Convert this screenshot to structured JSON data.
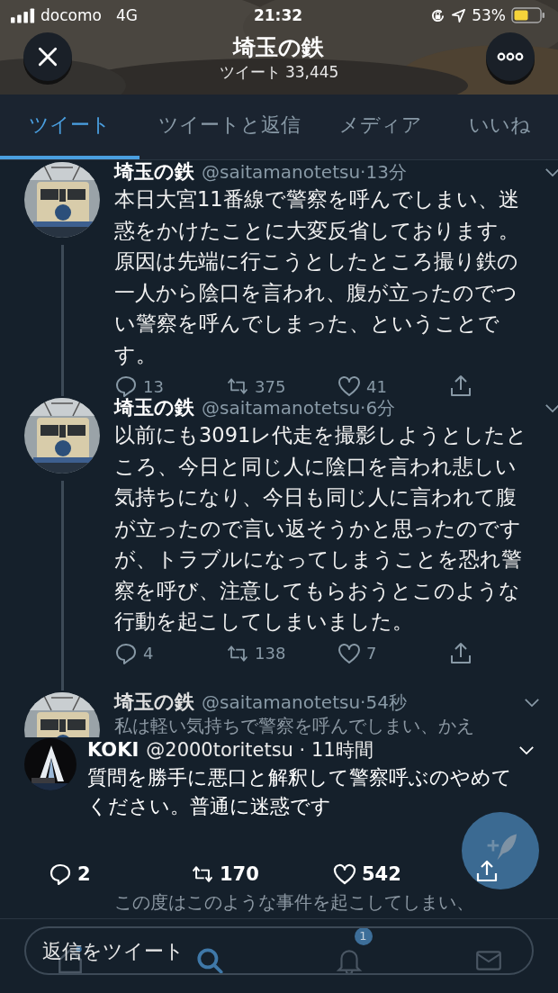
{
  "status_bar": {
    "carrier": "docomo",
    "network": "4G",
    "time": "21:32",
    "battery": "53%"
  },
  "header": {
    "title": "埼玉の鉄",
    "subtitle": "ツイート 33,445"
  },
  "tabs": [
    {
      "label": "ツイート",
      "selected": true
    },
    {
      "label": "ツイートと返信",
      "selected": false
    },
    {
      "label": "メディア",
      "selected": false
    },
    {
      "label": "いいね",
      "selected": false
    }
  ],
  "tweets": [
    {
      "name": "埼玉の鉄",
      "meta": "@saitamanotetsu·13分",
      "paragraphs": [
        "本日大宮11番線で警察を呼んでしまい、迷惑をかけたことに大変反省しております。",
        "原因は先端に行こうとしたところ撮り鉄の一人から陰口を言われ、腹が立ったのでつい警察を呼んでしまった、ということです。"
      ],
      "replies": "13",
      "retweets": "375",
      "likes": "41",
      "thread_line": true,
      "faded": false
    },
    {
      "name": "埼玉の鉄",
      "meta": "@saitamanotetsu·6分",
      "paragraphs": [
        "以前にも3091レ代走を撮影しようとしたところ、今日と同じ人に陰口を言われ悲しい気持ちになり、今日も同じ人に言われて腹が立ったので言い返そうかと思ったのですが、トラブルになってしまうことを恐れ警察を呼び、注意してもらおうとこのような行動を起こしてしまいました。"
      ],
      "replies": "4",
      "retweets": "138",
      "likes": "7",
      "thread_line": true,
      "faded": false
    },
    {
      "name": "埼玉の鉄",
      "meta": "@saitamanotetsu·54秒",
      "paragraphs": [
        "私は軽い気持ちで警察を呼んでしまい、かえ"
      ],
      "text_below_overlay": "この度はこのような事件を起こしてしまい、",
      "thread_line": false,
      "faded": true
    }
  ],
  "overlay_tweet": {
    "name": "KOKI",
    "meta": "@2000toritetsu · 11時間",
    "text": "質問を勝手に悪口と解釈して警察呼ぶのやめてください。普通に迷惑です",
    "replies": "2",
    "retweets": "170",
    "likes": "542"
  },
  "reply_field": {
    "placeholder": "返信をツイート"
  },
  "tab_bar": {
    "notification_badge": "1"
  }
}
